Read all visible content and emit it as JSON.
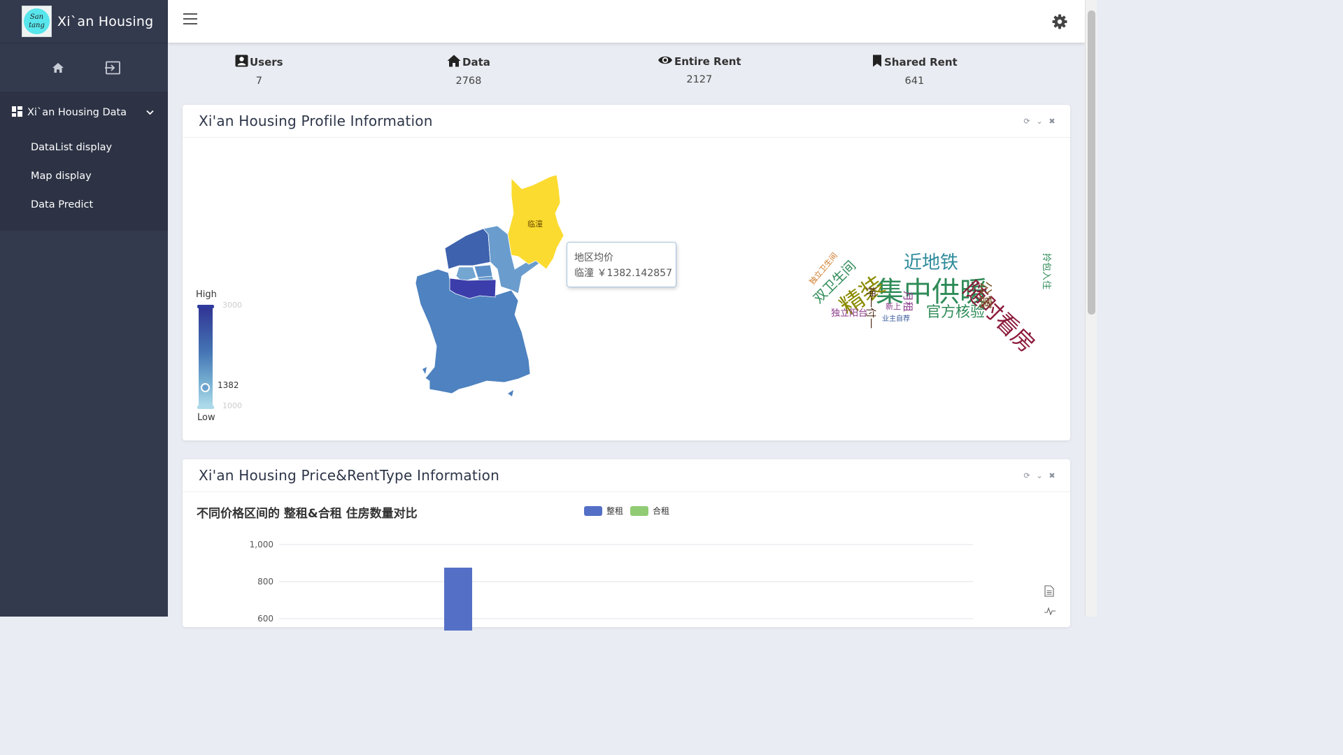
{
  "app": {
    "brand_title": "Xi`an Housing",
    "logo_line1": "San",
    "logo_line2": "tang"
  },
  "sidebar": {
    "group_label": "Xi`an Housing Data",
    "items": [
      {
        "label": "DataList display"
      },
      {
        "label": "Map display"
      },
      {
        "label": "Data Predict"
      }
    ]
  },
  "stats": [
    {
      "label": "Users",
      "value": "7",
      "icon": "user-icon"
    },
    {
      "label": "Data",
      "value": "2768",
      "icon": "home-icon"
    },
    {
      "label": "Entire Rent",
      "value": "2127",
      "icon": "eye-icon"
    },
    {
      "label": "Shared Rent",
      "value": "641",
      "icon": "bookmark-icon"
    }
  ],
  "profile_card": {
    "title": "Xi'an Housing Profile Information",
    "visual_map": {
      "high_label": "High",
      "low_label": "Low",
      "max": "3000",
      "min": "1000",
      "current": "1382",
      "current_value": 1382
    },
    "highlight_region": "临潼",
    "tooltip": {
      "title": "地区均价",
      "line": "临潼 ￥1382.142857"
    },
    "word_cloud": [
      "集中供暖",
      "随时看房",
      "精装",
      "近地铁",
      "官方核验",
      "双卫生间",
      "公寓",
      "独立阳台",
      "押一付一",
      "月租",
      "新上",
      "业主自荐",
      "拎包入住",
      "独立卫生间"
    ]
  },
  "price_card": {
    "title": "Xi'an Housing Price&RentType Information",
    "chart_data": {
      "type": "bar",
      "title": "不同价格区间的 整租&合租 住房数量对比",
      "series": [
        {
          "name": "整租",
          "color": "#5470c6"
        },
        {
          "name": "合租",
          "color": "#91cc75"
        }
      ],
      "yticks": [
        "1,000",
        "800",
        "600"
      ],
      "ylim": [
        0,
        1000
      ]
    }
  },
  "colors": {
    "sidebar": "#333a4d",
    "accent_yellow": "#fbdb2f",
    "map_dark": "#3b3eaa",
    "map_mid": "#4e82c0"
  }
}
